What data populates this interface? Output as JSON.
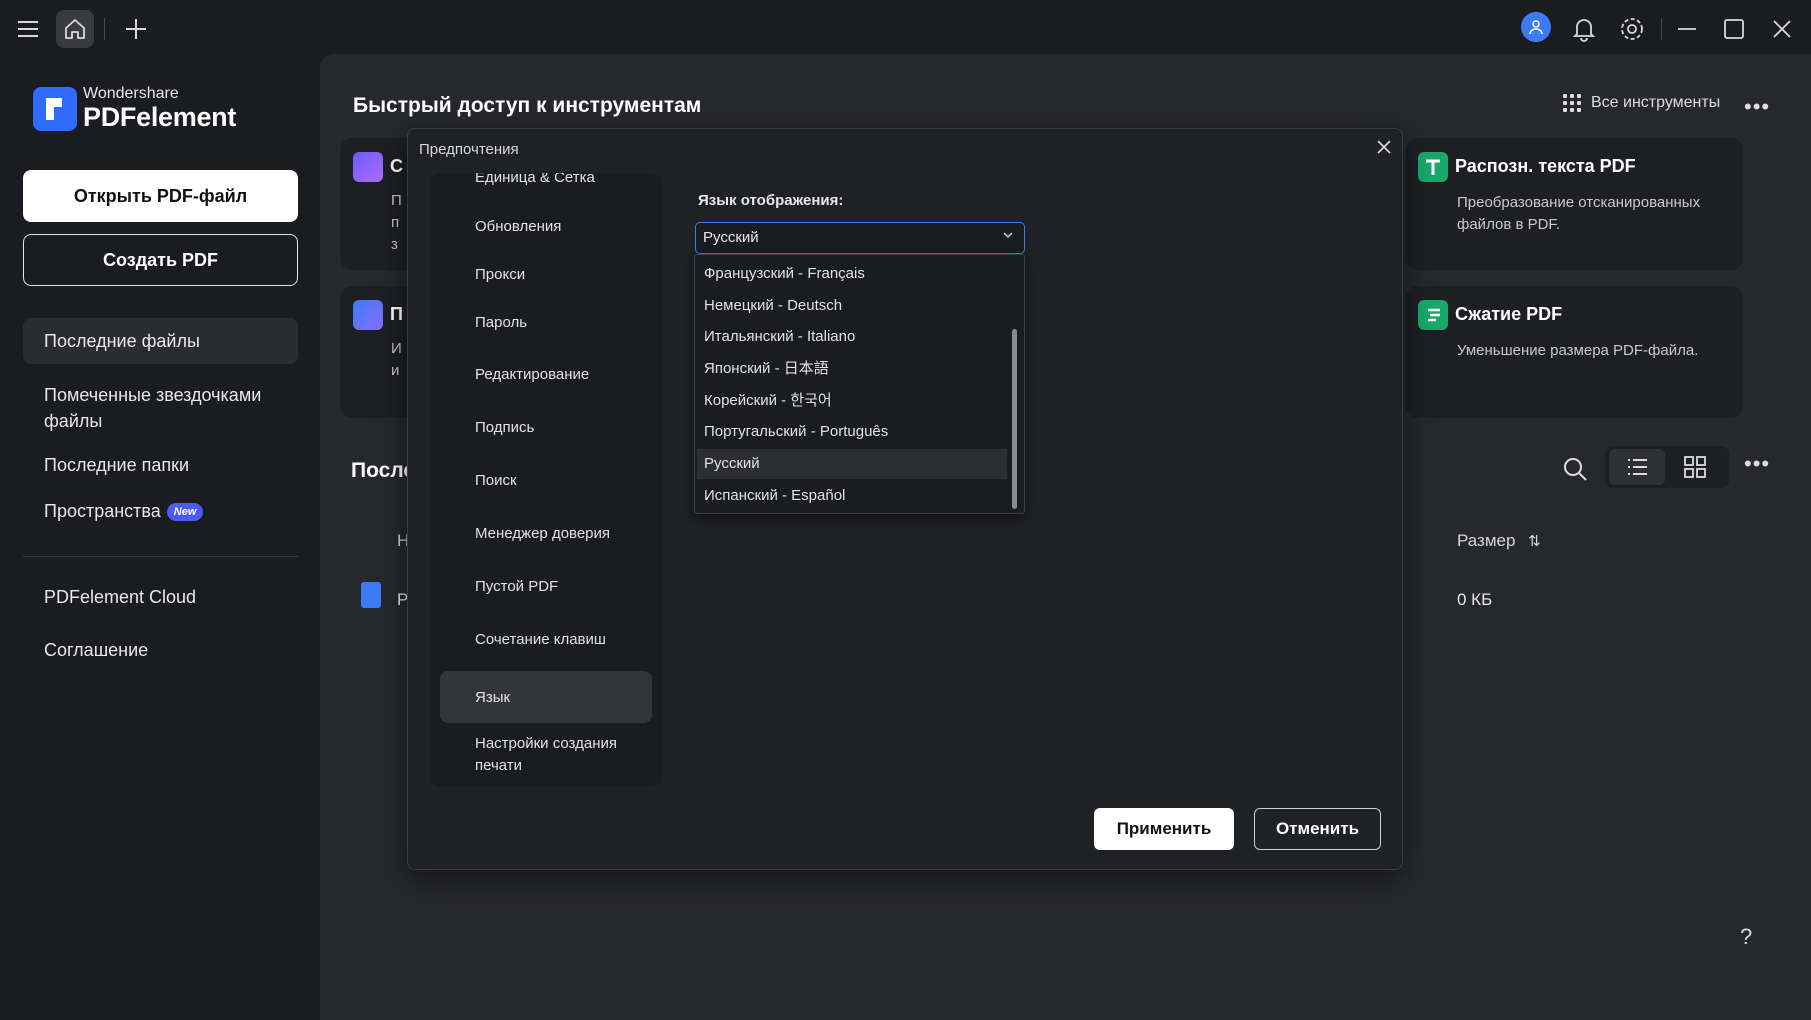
{
  "titlebar": {
    "icons": [
      "menu-icon",
      "home-icon",
      "plus-icon",
      "user-icon",
      "bell-icon",
      "gear-icon",
      "minimize-icon",
      "maximize-icon",
      "close-icon"
    ],
    "accent": "#3b7cf6"
  },
  "sidebar": {
    "logo_small": "Wondershare",
    "logo_big": "PDFelement",
    "open_pdf": "Открыть PDF-файл",
    "create_pdf": "Создать PDF",
    "items": [
      {
        "label": "Последние файлы"
      },
      {
        "label": "Помеченные звездочками файлы"
      },
      {
        "label": "Последние папки"
      },
      {
        "label": "Пространства",
        "badge": "New"
      },
      {
        "label": "PDFelement Cloud"
      },
      {
        "label": "Соглашение"
      }
    ]
  },
  "main": {
    "quick_access_title": "Быстрый доступ к инструментам",
    "all_tools": "Все инструменты",
    "more": "•••",
    "cards_left_partial": [
      {
        "title": "С",
        "desc": [
          "П",
          "п",
          "з"
        ]
      },
      {
        "title": "П",
        "desc": [
          "И",
          "и"
        ]
      }
    ],
    "cards_right": [
      {
        "title": "Распозн. текста PDF",
        "desc": "Преобразование отсканированных файлов в PDF.",
        "color": "#1aa86b"
      },
      {
        "title": "Сжатие PDF",
        "desc": "Уменьшение размера PDF-файла.",
        "color": "#1aa86b"
      }
    ],
    "recent_title_partial": "После",
    "columns": {
      "name_partial": "Н",
      "size": "Размер"
    },
    "rows": [
      {
        "name_partial": "Р",
        "size": "0 КБ"
      }
    ],
    "help": "?"
  },
  "dialog": {
    "title": "Предпочтения",
    "nav": [
      "Единица & Сетка",
      "Обновления",
      "Прокси",
      "Пароль",
      "Редактирование",
      "Подпись",
      "Поиск",
      "Менеджер доверия",
      "Пустой PDF",
      "Сочетание клавиш",
      "Язык",
      "Настройки создания печати"
    ],
    "active_nav": "Язык",
    "language_label": "Язык отображения:",
    "language_selected": "Русский",
    "language_options": [
      "Французский - Français",
      "Немецкий - Deutsch",
      "Итальянский - Italiano",
      "Японский - 日本語",
      "Корейский - 한국어",
      "Португальский - Português",
      "Русский",
      "Испанский - Español"
    ],
    "apply": "Применить",
    "cancel": "Отменить"
  }
}
